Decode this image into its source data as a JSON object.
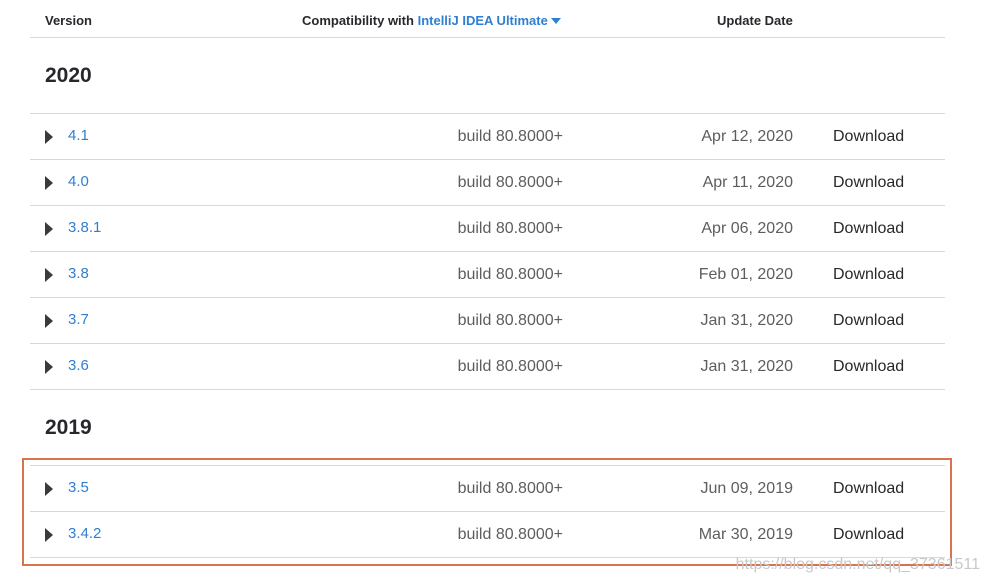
{
  "header": {
    "version_label": "Version",
    "compat_label": "Compatibility with",
    "compat_product": "IntelliJ IDEA Ultimate",
    "update_label": "Update Date"
  },
  "groups": [
    {
      "year": "2020",
      "rows": [
        {
          "version": "4.1",
          "build": "build 80.8000+",
          "date": "Apr 12, 2020",
          "action": "Download"
        },
        {
          "version": "4.0",
          "build": "build 80.8000+",
          "date": "Apr 11, 2020",
          "action": "Download"
        },
        {
          "version": "3.8.1",
          "build": "build 80.8000+",
          "date": "Apr 06, 2020",
          "action": "Download"
        },
        {
          "version": "3.8",
          "build": "build 80.8000+",
          "date": "Feb 01, 2020",
          "action": "Download"
        },
        {
          "version": "3.7",
          "build": "build 80.8000+",
          "date": "Jan 31, 2020",
          "action": "Download"
        },
        {
          "version": "3.6",
          "build": "build 80.8000+",
          "date": "Jan 31, 2020",
          "action": "Download"
        }
      ]
    },
    {
      "year": "2019",
      "rows": [
        {
          "version": "3.5",
          "build": "build 80.8000+",
          "date": "Jun 09, 2019",
          "action": "Download"
        },
        {
          "version": "3.4.2",
          "build": "build 80.8000+",
          "date": "Mar 30, 2019",
          "action": "Download"
        }
      ]
    }
  ],
  "watermark": "https://blog.csdn.net/qq_37361511",
  "colors": {
    "link": "#2f7fd1",
    "highlight_border": "#d9734e"
  }
}
